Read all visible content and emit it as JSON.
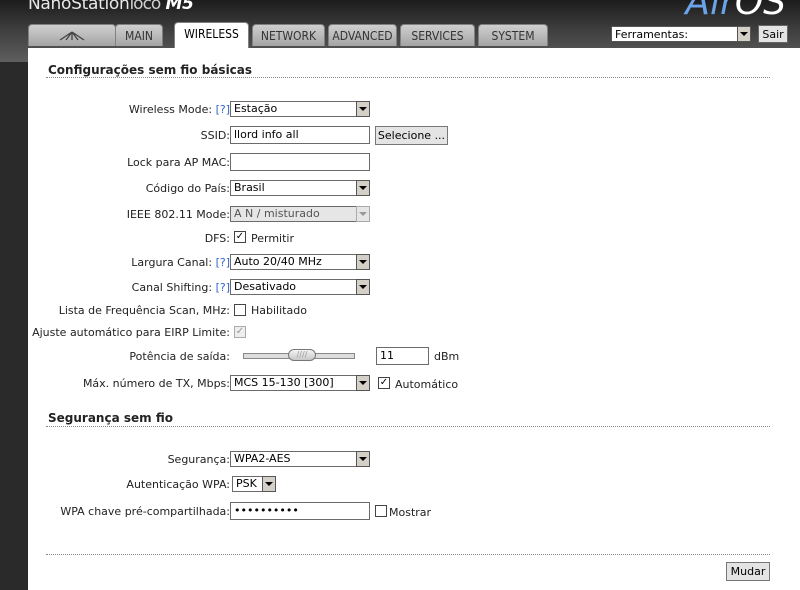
{
  "header": {
    "brand": "NanoStation",
    "brand_loco": "loco",
    "brand_model": "M5",
    "product_air": "Air",
    "product_os": "OS"
  },
  "tabs": [
    {
      "label": "",
      "icon": "ubiquiti-logo-icon"
    },
    {
      "label": "MAIN"
    },
    {
      "label": "WIRELESS",
      "active": true
    },
    {
      "label": "NETWORK"
    },
    {
      "label": "ADVANCED"
    },
    {
      "label": "SERVICES"
    },
    {
      "label": "SYSTEM"
    }
  ],
  "tools": {
    "selected": "Ferramentas:",
    "logout": "Sair"
  },
  "basic": {
    "title": "Configurações sem fio básicas",
    "wireless_mode_label": "Wireless Mode:",
    "wireless_mode_help": "[?]",
    "wireless_mode_value": "Estação",
    "ssid_label": "SSID:",
    "ssid_value": "llord info all",
    "ssid_select": "Selecione ...",
    "lock_label": "Lock para AP MAC:",
    "lock_value": "",
    "country_label": "Código do País:",
    "country_value": "Brasil",
    "ieee_label": "IEEE 802.11 Mode:",
    "ieee_value": "A N / misturado",
    "dfs_label": "DFS:",
    "dfs_checkbox_label": "Permitir",
    "dfs_checked": true,
    "channel_width_label": "Largura Canal:",
    "channel_width_help": "[?]",
    "channel_width_value": "Auto 20/40 MHz",
    "channel_shift_label": "Canal Shifting:",
    "channel_shift_help": "[?]",
    "channel_shift_value": "Desativado",
    "scan_label": "Lista de Frequência Scan, MHz:",
    "scan_checkbox_label": "Habilitado",
    "scan_checked": false,
    "eirp_label": "Ajuste automático para EIRP Limite:",
    "eirp_checked": true,
    "power_label": "Potência de saída:",
    "power_value": "11",
    "power_unit": "dBm",
    "power_slider_glyph": "////",
    "tx_label": "Máx. número de TX, Mbps:",
    "tx_value": "MCS 15-130 [300]",
    "tx_auto_label": "Automático",
    "tx_auto_checked": true
  },
  "security": {
    "title": "Segurança sem fio",
    "security_label": "Segurança:",
    "security_value": "WPA2-AES",
    "auth_label": "Autenticação WPA:",
    "auth_value": "PSK",
    "key_label": "WPA chave pré-compartilhada:",
    "key_value": "••••••••••",
    "show_label": "Mostrar",
    "show_checked": false
  },
  "footer": {
    "apply_label": "Mudar"
  }
}
